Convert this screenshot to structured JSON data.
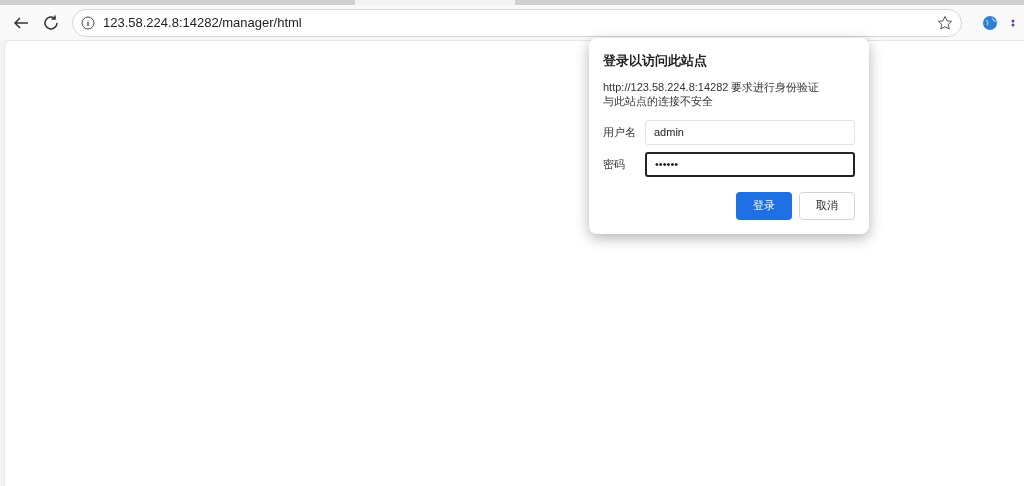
{
  "address_bar": {
    "url": "123.58.224.8:14282/manager/html"
  },
  "dialog": {
    "title": "登录以访问此站点",
    "message": "http://123.58.224.8:14282 要求进行身份验证",
    "warning": "与此站点的连接不安全",
    "fields": [
      {
        "label": "用户名",
        "value": "admin",
        "focused": false
      },
      {
        "label": "密码",
        "value": "••••••",
        "focused": true
      }
    ],
    "buttons": [
      {
        "label": "登录",
        "primary": true
      },
      {
        "label": "取消",
        "primary": false
      }
    ]
  }
}
